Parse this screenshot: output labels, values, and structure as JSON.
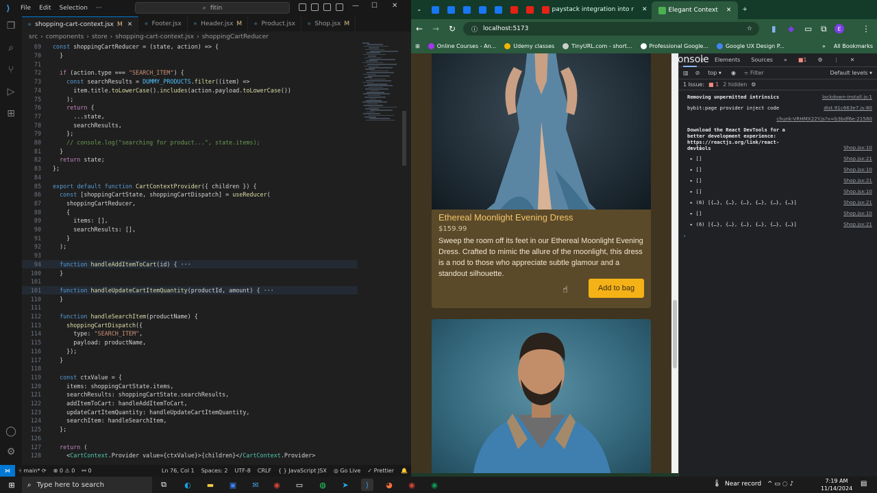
{
  "vscode": {
    "menu": [
      "File",
      "Edit",
      "Selection"
    ],
    "command_center": "fitin",
    "tabs": [
      {
        "label": "shopping-cart-context.jsx",
        "badge": "M"
      },
      {
        "label": "Footer.jsx",
        "badge": ""
      },
      {
        "label": "Header.jsx",
        "badge": "M"
      },
      {
        "label": "Product.jsx",
        "badge": ""
      },
      {
        "label": "Shop.jsx",
        "badge": "M"
      }
    ],
    "breadcrumb": [
      "src",
      "components",
      "store",
      "shopping-cart-context.jsx",
      "shoppingCartReducer"
    ],
    "code": [
      {
        "n": "69",
        "t": "const shoppingCartReducer = (state, action) => {"
      },
      {
        "n": "70",
        "t": "  }"
      },
      {
        "n": "71",
        "t": ""
      },
      {
        "n": "72",
        "t": "  if (action.type === \"SEARCH_ITEM\") {"
      },
      {
        "n": "73",
        "t": "    const searchResults = DUMMY_PRODUCTS.filter((item) =>"
      },
      {
        "n": "74",
        "t": "      item.title.toLowerCase().includes(action.payload.toLowerCase())"
      },
      {
        "n": "75",
        "t": "    );"
      },
      {
        "n": "76",
        "t": "    return {"
      },
      {
        "n": "77",
        "t": "      ...state,"
      },
      {
        "n": "78",
        "t": "      searchResults,"
      },
      {
        "n": "79",
        "t": "    };"
      },
      {
        "n": "80",
        "t": "    // console.log(\"searching for product...\", state.items);"
      },
      {
        "n": "81",
        "t": "  }"
      },
      {
        "n": "82",
        "t": "  return state;"
      },
      {
        "n": "83",
        "t": "};"
      },
      {
        "n": "84",
        "t": ""
      },
      {
        "n": "85",
        "t": "export default function CartContextProvider({ children }) {"
      },
      {
        "n": "86",
        "t": "  const [shoppingCartState, shoppingCartDispatch] = useReducer("
      },
      {
        "n": "87",
        "t": "    shoppingCartReducer,"
      },
      {
        "n": "88",
        "t": "    {"
      },
      {
        "n": "89",
        "t": "      items: [],"
      },
      {
        "n": "90",
        "t": "      searchResults: [],"
      },
      {
        "n": "91",
        "t": "    }"
      },
      {
        "n": "92",
        "t": "  );"
      },
      {
        "n": "93",
        "t": ""
      },
      {
        "n": "94",
        "t": "  function handleAddItemToCart(id) { ···"
      },
      {
        "n": "100",
        "t": "  }"
      },
      {
        "n": "101",
        "t": ""
      },
      {
        "n": "101",
        "t": "  function handleUpdateCartItemQuantity(productId, amount) { ···"
      },
      {
        "n": "110",
        "t": "  }"
      },
      {
        "n": "111",
        "t": ""
      },
      {
        "n": "112",
        "t": "  function handleSearchItem(productName) {"
      },
      {
        "n": "113",
        "t": "    shoppingCartDispatch({"
      },
      {
        "n": "114",
        "t": "      type: \"SEARCH_ITEM\","
      },
      {
        "n": "115",
        "t": "      payload: productName,"
      },
      {
        "n": "116",
        "t": "    });"
      },
      {
        "n": "117",
        "t": "  }"
      },
      {
        "n": "118",
        "t": ""
      },
      {
        "n": "119",
        "t": "  const ctxValue = {"
      },
      {
        "n": "120",
        "t": "    items: shoppingCartState.items,"
      },
      {
        "n": "121",
        "t": "    searchResults: shoppingCartState.searchResults,"
      },
      {
        "n": "122",
        "t": "    addItemToCart: handleAddItemToCart,"
      },
      {
        "n": "123",
        "t": "    updateCartItemQuantity: handleUpdateCartItemQuantity,"
      },
      {
        "n": "124",
        "t": "    searchItem: handleSearchItem,"
      },
      {
        "n": "125",
        "t": "  };"
      },
      {
        "n": "126",
        "t": ""
      },
      {
        "n": "127",
        "t": "  return ("
      },
      {
        "n": "128",
        "t": "    <CartContext.Provider value={ctxValue}>{children}</CartContext.Provider>"
      }
    ],
    "status": {
      "branch": "main*",
      "errors": "0",
      "warnings": "0",
      "ports": "0",
      "position": "Ln 76, Col 1",
      "spaces": "Spaces: 2",
      "encoding": "UTF-8",
      "eol": "CRLF",
      "language": "JavaScript JSX",
      "golive": "Go Live",
      "prettier": "Prettier"
    }
  },
  "browser": {
    "tabs": [
      {
        "label": "",
        "color": "#1877f2"
      },
      {
        "label": "",
        "color": "#1877f2"
      },
      {
        "label": "",
        "color": "#1877f2"
      },
      {
        "label": "",
        "color": "#1877f2"
      },
      {
        "label": "",
        "color": "#1877f2"
      },
      {
        "label": "",
        "color": "#e62117"
      },
      {
        "label": "",
        "color": "#e62117"
      },
      {
        "label": "paystack integration into r",
        "color": "#e62117"
      },
      {
        "label": "Elegant Context",
        "color": "#4caf50"
      }
    ],
    "url": "localhost:5173",
    "bookmarks": [
      {
        "label": "Online Courses - An...",
        "color": "#a435f0"
      },
      {
        "label": "Udemy classes",
        "color": "#f4b400"
      },
      {
        "label": "TinyURL.com - short...",
        "color": "#ccc"
      },
      {
        "label": "Professional Google...",
        "color": "#fff"
      },
      {
        "label": "Google UX Design P...",
        "color": "#4285f4"
      }
    ],
    "all_bookmarks": "All Bookmarks",
    "product": {
      "title": "Ethereal Moonlight Evening Dress",
      "price": "$159.99",
      "description": "Sweep the room off its feet in our Ethereal Moonlight Evening Dress. Crafted to mimic the allure of the moonlight, this dress is a nod to those who appreciate subtle glamour and a standout silhouette.",
      "button": "Add to bag"
    },
    "devtools": {
      "tabs": [
        "Elements",
        "Console",
        "Sources"
      ],
      "active_tab": "Console",
      "error_count": "1",
      "context": "top",
      "filter_placeholder": "Filter",
      "levels": "Default levels",
      "issues": "1 Issue:",
      "issues_count": "1",
      "hidden": "2 hidden",
      "logs": [
        {
          "msg": "Removing unpermitted intrinsics",
          "src": "lockdown-install.js:1",
          "bold": true
        },
        {
          "msg": "bybit:page provider inject code",
          "src": "dist.91c663e7.js:80",
          "bold": false
        },
        {
          "msg": "",
          "src": "chunk-VRHMX22Y.js?v=b3bdf6e:21580",
          "bold": false
        },
        {
          "msg": "Download the React DevTools for a better development experience: https://reactjs.org/link/react-devtools",
          "src": "",
          "bold": true
        },
        {
          "msg": "▸ []",
          "src": "Shop.jsx:10",
          "bold": false
        },
        {
          "msg": "▸ []",
          "src": "Shop.jsx:21",
          "bold": false
        },
        {
          "msg": "▸ []",
          "src": "Shop.jsx:10",
          "bold": false
        },
        {
          "msg": "▸ []",
          "src": "Shop.jsx:21",
          "bold": false
        },
        {
          "msg": "▸ []",
          "src": "Shop.jsx:10",
          "bold": false
        },
        {
          "msg": "▸ (6) [{…}, {…}, {…}, {…}, {…}, {…}]",
          "src": "Shop.jsx:21",
          "bold": false
        },
        {
          "msg": "▸ []",
          "src": "Shop.jsx:10",
          "bold": false
        },
        {
          "msg": "▸ (6) [{…}, {…}, {…}, {…}, {…}, {…}]",
          "src": "Shop.jsx:21",
          "bold": false
        }
      ]
    }
  },
  "taskbar": {
    "search_placeholder": "Type here to search",
    "weather": "Near record",
    "time": "7:19 AM",
    "date": "11/14/2024"
  }
}
